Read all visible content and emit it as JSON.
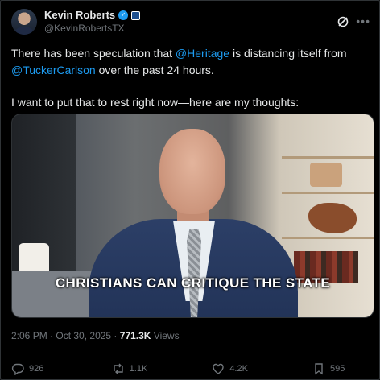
{
  "author": {
    "name": "Kevin Roberts",
    "handle": "@KevinRobertsTX",
    "verified_icon": "verified-badge-icon",
    "affiliate_icon": "heritage-affiliate-icon"
  },
  "tweet": {
    "line1_prefix": "There has been speculation that ",
    "mention1": "@Heritage",
    "line1_suffix": " is distancing itself from",
    "mention2": "@TuckerCarlson",
    "line2_suffix": " over the past 24 hours.",
    "paragraph2": "I want to put that to rest right now—here are my thoughts:"
  },
  "video": {
    "caption": "CHRISTIANS CAN CRITIQUE THE STATE"
  },
  "meta": {
    "time": "2:06 PM",
    "sep1": " · ",
    "date": "Oct 30, 2025",
    "sep2": " · ",
    "views_count": "771.3K",
    "views_label": " Views"
  },
  "actions": {
    "replies": "926",
    "reposts": "1.1K",
    "likes": "4.2K",
    "bookmarks": "595"
  },
  "colors": {
    "accent": "#1d9bf0",
    "muted": "#71767b",
    "text": "#e7e9ea"
  }
}
